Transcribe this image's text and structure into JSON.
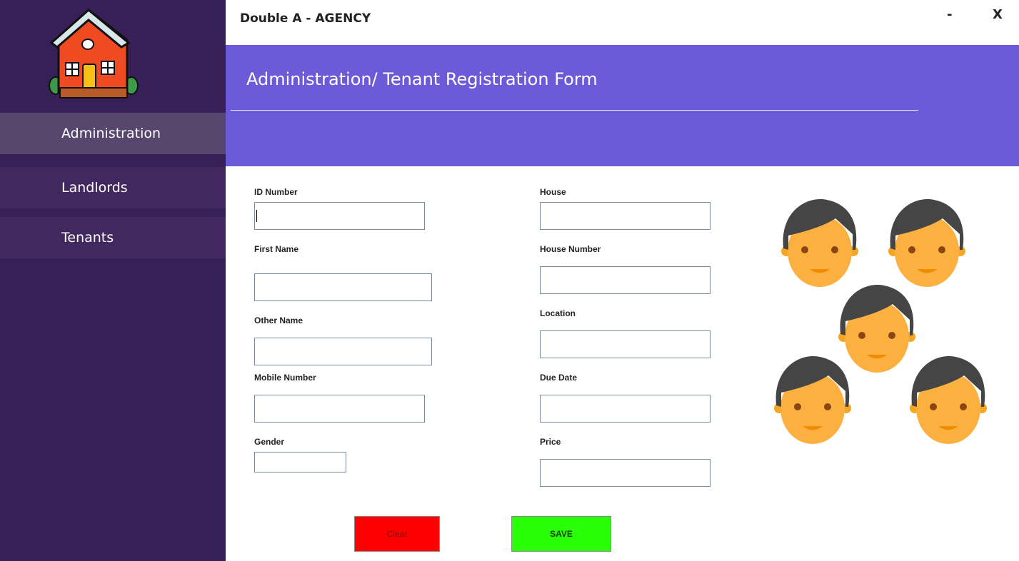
{
  "app": {
    "title": "Double A - AGENCY",
    "minimize": "-",
    "close": "X"
  },
  "sidebar": {
    "logo_icon": "house-icon",
    "items": [
      {
        "label": "Administration",
        "active": true
      },
      {
        "label": "Landlords",
        "active": false
      },
      {
        "label": "Tenants",
        "active": false
      }
    ]
  },
  "header": {
    "title": "Administration/ Tenant Registration Form"
  },
  "form": {
    "left": [
      {
        "label": "ID Number",
        "value": ""
      },
      {
        "label": "First Name",
        "value": ""
      },
      {
        "label": "Other Name",
        "value": ""
      },
      {
        "label": "Mobile Number",
        "value": ""
      },
      {
        "label": "Gender",
        "value": ""
      }
    ],
    "right": [
      {
        "label": "House",
        "value": ""
      },
      {
        "label": "House Number",
        "value": ""
      },
      {
        "label": "Location",
        "value": ""
      },
      {
        "label": "Due Date",
        "value": ""
      },
      {
        "label": "Price",
        "value": ""
      }
    ]
  },
  "buttons": {
    "clear": "Clear",
    "save": "SAVE"
  },
  "illustration": {
    "icon": "people-faces-icon"
  },
  "colors": {
    "sidebar": "#362057",
    "header": "#6c5ad9",
    "clear_button": "#ff0000",
    "save_button": "#2aff0a"
  }
}
